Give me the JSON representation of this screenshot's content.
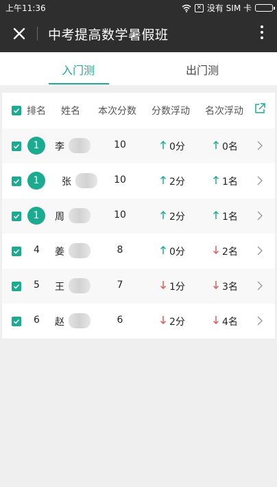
{
  "status_bar": {
    "time": "上午11:36",
    "carrier": "没有 SIM 卡"
  },
  "navbar": {
    "title": "中考提高数学暑假班"
  },
  "tabs": [
    {
      "label": "入门测",
      "active": true
    },
    {
      "label": "出门测",
      "active": false
    }
  ],
  "table": {
    "headers": {
      "rank": "排名",
      "name": "姓名",
      "score": "本次分数",
      "score_change": "分数浮动",
      "rank_change": "名次浮动"
    },
    "rows": [
      {
        "rank": "1",
        "name": "李",
        "score": "10",
        "score_change": "0分",
        "score_dir": "up",
        "rank_change": "0名",
        "rank_dir": "up",
        "badge": true
      },
      {
        "rank": "1",
        "name": "张",
        "score": "10",
        "score_change": "2分",
        "score_dir": "up",
        "rank_change": "1名",
        "rank_dir": "up",
        "badge": true
      },
      {
        "rank": "1",
        "name": "周",
        "score": "10",
        "score_change": "2分",
        "score_dir": "up",
        "rank_change": "1名",
        "rank_dir": "up",
        "badge": true
      },
      {
        "rank": "4",
        "name": "姜",
        "score": "8",
        "score_change": "0分",
        "score_dir": "up",
        "rank_change": "2名",
        "rank_dir": "down",
        "badge": false
      },
      {
        "rank": "5",
        "name": "王",
        "score": "7",
        "score_change": "1分",
        "score_dir": "down",
        "rank_change": "3名",
        "rank_dir": "down",
        "badge": false
      },
      {
        "rank": "6",
        "name": "赵",
        "score": "6",
        "score_change": "2分",
        "score_dir": "down",
        "rank_change": "4名",
        "rank_dir": "down",
        "badge": false
      }
    ]
  },
  "colors": {
    "accent": "#1aab91",
    "up": "#1aab91",
    "down": "#e05a5a",
    "header_bg": "#2e2e2e"
  }
}
